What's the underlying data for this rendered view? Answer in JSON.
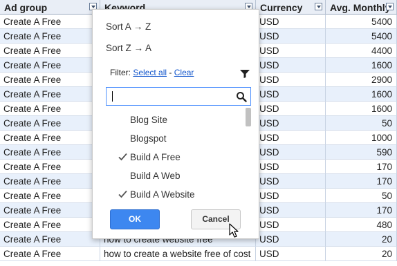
{
  "table": {
    "headers": [
      "Ad group",
      "Keyword",
      "Currency",
      "Avg. Monthly"
    ],
    "rows": [
      {
        "ad_group": "Create A Free",
        "keyword": "",
        "currency": "USD",
        "avg": "5400"
      },
      {
        "ad_group": "Create A Free",
        "keyword": "",
        "currency": "USD",
        "avg": "5400"
      },
      {
        "ad_group": "Create A Free",
        "keyword": "",
        "currency": "USD",
        "avg": "4400"
      },
      {
        "ad_group": "Create A Free",
        "keyword": "",
        "currency": "USD",
        "avg": "1600"
      },
      {
        "ad_group": "Create A Free",
        "keyword": "",
        "currency": "USD",
        "avg": "2900"
      },
      {
        "ad_group": "Create A Free",
        "keyword": "",
        "currency": "USD",
        "avg": "1600"
      },
      {
        "ad_group": "Create A Free",
        "keyword": "",
        "currency": "USD",
        "avg": "1600"
      },
      {
        "ad_group": "Create A Free",
        "keyword": "",
        "currency": "USD",
        "avg": "50"
      },
      {
        "ad_group": "Create A Free",
        "keyword": "",
        "currency": "USD",
        "avg": "1000"
      },
      {
        "ad_group": "Create A Free",
        "keyword": "",
        "currency": "USD",
        "avg": "590"
      },
      {
        "ad_group": "Create A Free",
        "keyword": "",
        "currency": "USD",
        "avg": "170"
      },
      {
        "ad_group": "Create A Free",
        "keyword": "",
        "currency": "USD",
        "avg": "170"
      },
      {
        "ad_group": "Create A Free",
        "keyword": "",
        "currency": "USD",
        "avg": "50"
      },
      {
        "ad_group": "Create A Free",
        "keyword": "",
        "currency": "USD",
        "avg": "170"
      },
      {
        "ad_group": "Create A Free",
        "keyword": "",
        "currency": "USD",
        "avg": "480"
      },
      {
        "ad_group": "Create A Free",
        "keyword": "how to create website free",
        "currency": "USD",
        "avg": "20"
      },
      {
        "ad_group": "Create A Free",
        "keyword": "how to create a website free of cost",
        "currency": "USD",
        "avg": "20"
      }
    ]
  },
  "popup": {
    "sort_asc": "Sort A → Z",
    "sort_desc": "Sort Z → A",
    "filter_label": "Filter:",
    "select_all": "Select all",
    "separator": "-",
    "clear": "Clear",
    "search_value": "",
    "options": [
      {
        "label": "Blog Site",
        "checked": false
      },
      {
        "label": "Blogspot",
        "checked": false
      },
      {
        "label": "Build A Free",
        "checked": true
      },
      {
        "label": "Build A Web",
        "checked": false
      },
      {
        "label": "Build A Website",
        "checked": true
      }
    ],
    "ok_label": "OK",
    "cancel_label": "Cancel"
  },
  "colors": {
    "accent_blue": "#3d87f0",
    "link_blue": "#1155cc",
    "header_bg": "#e9eef6",
    "alt_row": "#e8f0fb"
  }
}
